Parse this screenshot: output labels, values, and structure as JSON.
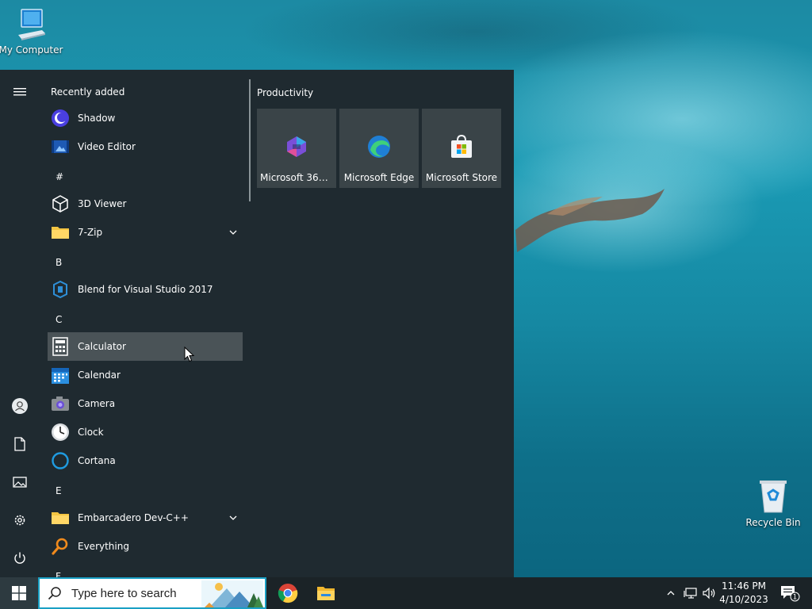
{
  "desktop": {
    "icons": [
      {
        "label": "My Computer"
      },
      {
        "label": "Recycle Bin"
      }
    ]
  },
  "start_menu": {
    "recently_added_title": "Recently added",
    "apps": {
      "shadow": "Shadow",
      "video_editor": "Video Editor",
      "hash": "#",
      "viewer_3d": "3D Viewer",
      "seven_zip": "7-Zip",
      "letter_b": "B",
      "blend": "Blend for Visual Studio 2017",
      "letter_c": "C",
      "calculator": "Calculator",
      "calendar": "Calendar",
      "camera": "Camera",
      "clock": "Clock",
      "cortana": "Cortana",
      "letter_e": "E",
      "devcpp": "Embarcadero Dev-C++",
      "everything": "Everything",
      "letter_f": "F"
    },
    "tile_group": "Productivity",
    "tiles": [
      {
        "label": "Microsoft 365..."
      },
      {
        "label": "Microsoft Edge"
      },
      {
        "label": "Microsoft Store"
      }
    ]
  },
  "taskbar": {
    "search_placeholder": "Type here to search",
    "time": "11:46 PM",
    "date": "4/10/2023",
    "notification_count": "1"
  },
  "colors": {
    "start_menu_bg": "#1f2a30",
    "tile_bg": "#3a4448",
    "taskbar_bg": "#1b2327",
    "search_border": "#1aa0c4",
    "hover_bg": "#4a5357"
  }
}
